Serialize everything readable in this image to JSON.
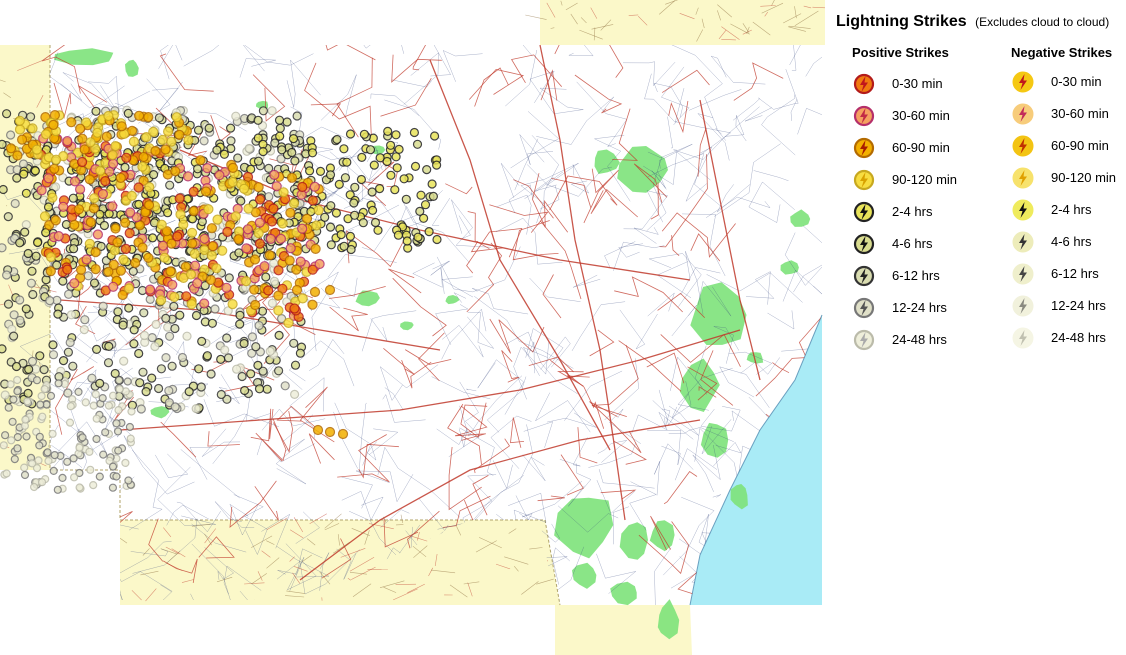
{
  "legend": {
    "title": "Lightning Strikes",
    "subtitle": "(Excludes cloud to cloud)",
    "positive_heading": "Positive Strikes",
    "negative_heading": "Negative Strikes",
    "positive": [
      {
        "label": "0-30 min",
        "fill": "#f07a10",
        "ring": "#b31b1b",
        "bolt": "#c0161c"
      },
      {
        "label": "30-60 min",
        "fill": "#f5a060",
        "ring": "#b52f6a",
        "bolt": "#c22a45"
      },
      {
        "label": "60-90 min",
        "fill": "#f3b000",
        "ring": "#b36a00",
        "bolt": "#a81d00"
      },
      {
        "label": "90-120 min",
        "fill": "#f7dd40",
        "ring": "#c7a820",
        "bolt": "#d8a200"
      },
      {
        "label": "2-4 hrs",
        "fill": "#e8e35a",
        "ring": "#222222",
        "bolt": "#111111"
      },
      {
        "label": "4-6 hrs",
        "fill": "#d9dc90",
        "ring": "#222222",
        "bolt": "#111111"
      },
      {
        "label": "6-12 hrs",
        "fill": "#d9dcb0",
        "ring": "#333333",
        "bolt": "#222222"
      },
      {
        "label": "12-24 hrs",
        "fill": "#e0e0c8",
        "ring": "#777777",
        "bolt": "#555555"
      },
      {
        "label": "24-48 hrs",
        "fill": "#eeeeda",
        "ring": "#bbbbaa",
        "bolt": "#aaaaaa"
      }
    ],
    "negative": [
      {
        "label": "0-30 min",
        "fill": "#f5c400",
        "bolt": "#c0161c"
      },
      {
        "label": "30-60 min",
        "fill": "#f7c870",
        "bolt": "#c22a5a"
      },
      {
        "label": "60-90 min",
        "fill": "#f3c000",
        "bolt": "#c03000"
      },
      {
        "label": "90-120 min",
        "fill": "#f7e060",
        "bolt": "#e0a000"
      },
      {
        "label": "2-4 hrs",
        "fill": "#eeea50",
        "bolt": "#111111"
      },
      {
        "label": "4-6 hrs",
        "fill": "#ecebb5",
        "bolt": "#333333"
      },
      {
        "label": "6-12 hrs",
        "fill": "#eeeec8",
        "bolt": "#444444"
      },
      {
        "label": "12-24 hrs",
        "fill": "#f0f0da",
        "bolt": "#8a8a80"
      },
      {
        "label": "24-48 hrs",
        "fill": "#f5f5e2",
        "bolt": "#c0c0b0"
      }
    ]
  },
  "map": {
    "land_color": "#ffffff",
    "outer_region_color": "#fbf8c9",
    "ocean_color": "#a9ebf6",
    "park_color": "#7de27a",
    "major_road_color": "#c0392b",
    "minor_road_color": "#2c3e7a"
  }
}
